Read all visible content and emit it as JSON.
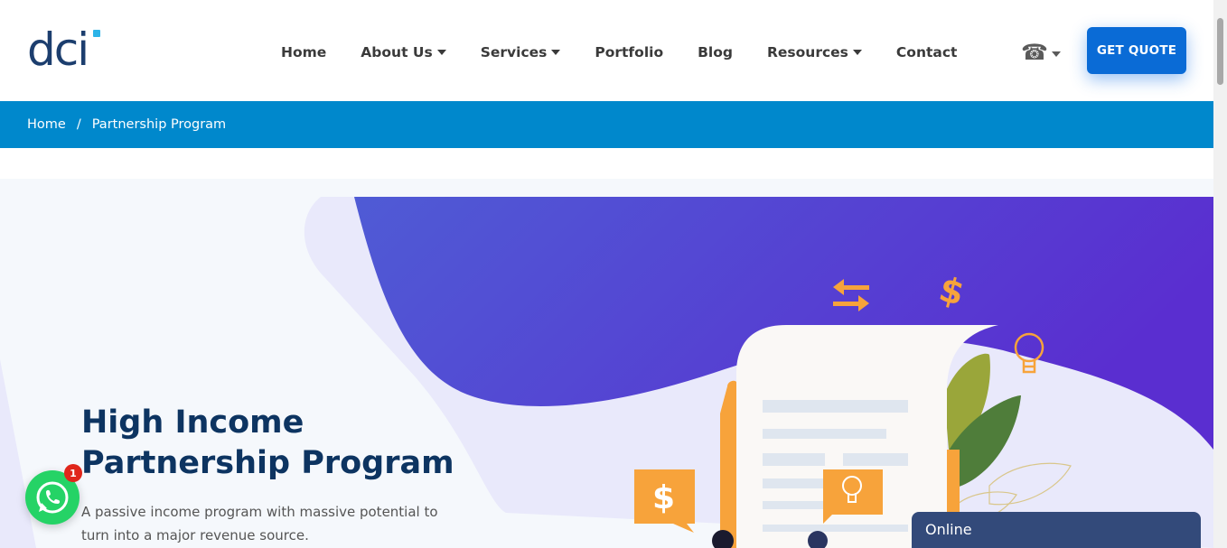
{
  "header": {
    "logo_text": "dci",
    "nav": [
      {
        "label": "Home",
        "dropdown": false
      },
      {
        "label": "About Us",
        "dropdown": true
      },
      {
        "label": "Services",
        "dropdown": true
      },
      {
        "label": "Portfolio",
        "dropdown": false
      },
      {
        "label": "Blog",
        "dropdown": false
      },
      {
        "label": "Resources",
        "dropdown": true
      },
      {
        "label": "Contact",
        "dropdown": false
      }
    ],
    "phone_icon": "☎",
    "cta_label": "GET QUOTE"
  },
  "breadcrumb": {
    "items": [
      "Home",
      "Partnership Program"
    ],
    "separator": "/"
  },
  "hero": {
    "title_line1": "High Income",
    "title_line2": "Partnership Program",
    "subtitle": "A passive income program with massive potential to turn into a major revenue source."
  },
  "whatsapp": {
    "badge_count": "1"
  },
  "chat": {
    "status": "Online"
  },
  "colors": {
    "brand_blue": "#0a6bd6",
    "breadcrumb_bg": "#0088cc",
    "title_navy": "#0d3461",
    "accent_orange": "#f7a33b",
    "purple_gradient_start": "#4f5bd5",
    "purple_gradient_end": "#5a2ed0"
  }
}
